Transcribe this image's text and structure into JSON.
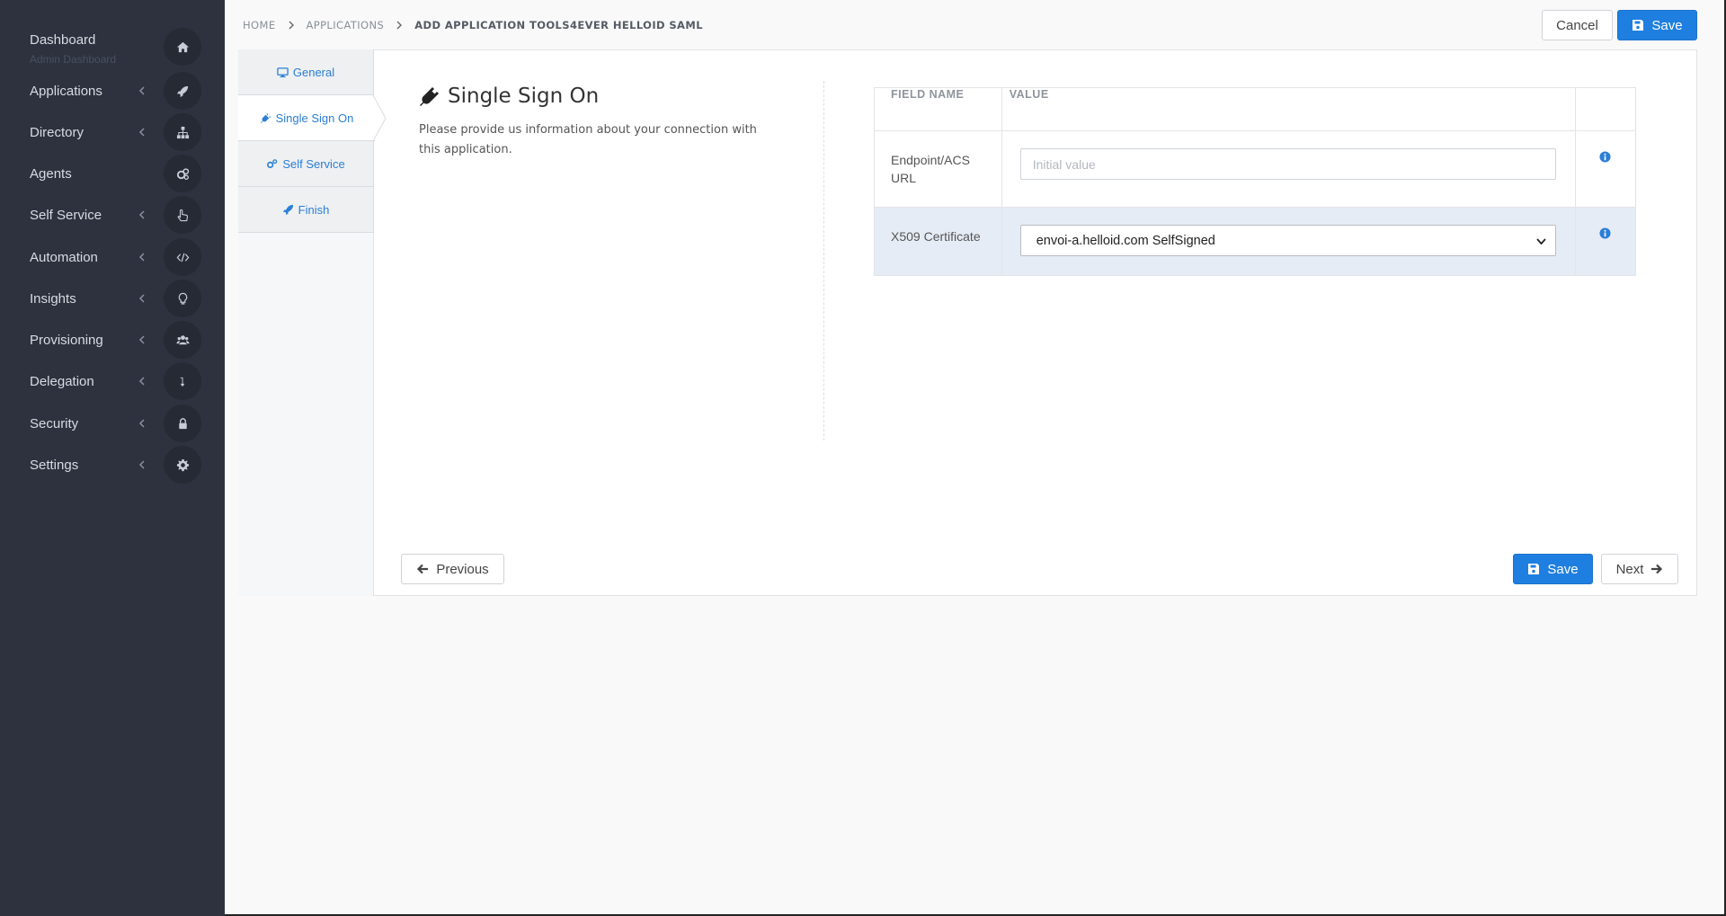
{
  "sidebar": {
    "items": [
      {
        "label": "Dashboard",
        "sub": "Admin Dashboard",
        "icon": "home-icon",
        "chevron": false
      },
      {
        "label": "Applications",
        "icon": "rocket-icon",
        "chevron": true
      },
      {
        "label": "Directory",
        "icon": "sitemap-icon",
        "chevron": true
      },
      {
        "label": "Agents",
        "icon": "cogs-icon",
        "chevron": false
      },
      {
        "label": "Self Service",
        "icon": "hand-pointer-icon",
        "chevron": true
      },
      {
        "label": "Automation",
        "icon": "code-icon",
        "chevron": true
      },
      {
        "label": "Insights",
        "icon": "lightbulb-icon",
        "chevron": true
      },
      {
        "label": "Provisioning",
        "icon": "users-icon",
        "chevron": true
      },
      {
        "label": "Delegation",
        "icon": "level-down-icon",
        "chevron": true
      },
      {
        "label": "Security",
        "icon": "lock-icon",
        "chevron": true
      },
      {
        "label": "Settings",
        "icon": "gear-icon",
        "chevron": true
      }
    ]
  },
  "breadcrumb": {
    "home": "HOME",
    "applications": "APPLICATIONS",
    "current": "ADD APPLICATION TOOLS4EVER HELLOID SAML"
  },
  "header": {
    "cancel_label": "Cancel",
    "save_label": "Save"
  },
  "steps": [
    {
      "label": "General",
      "icon": "desktop-icon"
    },
    {
      "label": "Single Sign On",
      "icon": "plug-icon"
    },
    {
      "label": "Self Service",
      "icon": "cogs-icon"
    },
    {
      "label": "Finish",
      "icon": "rocket-icon"
    }
  ],
  "section": {
    "title": "Single Sign On",
    "description": "Please provide us information about your connection with this application."
  },
  "table": {
    "columns": [
      "FIELD NAME",
      "VALUE",
      ""
    ],
    "rows": [
      {
        "name": "Endpoint/ACS URL",
        "placeholder": "Initial value",
        "value": ""
      },
      {
        "name": "X509 Certificate",
        "selected": "envoi-a.helloid.com SelfSigned"
      }
    ]
  },
  "footer": {
    "previous_label": "Previous",
    "save_label": "Save",
    "next_label": "Next"
  },
  "colors": {
    "sidebar_bg": "#2d323e",
    "primary": "#1f7fe0",
    "link": "#2b7fd6",
    "highlight_row": "#e6ecf5"
  }
}
